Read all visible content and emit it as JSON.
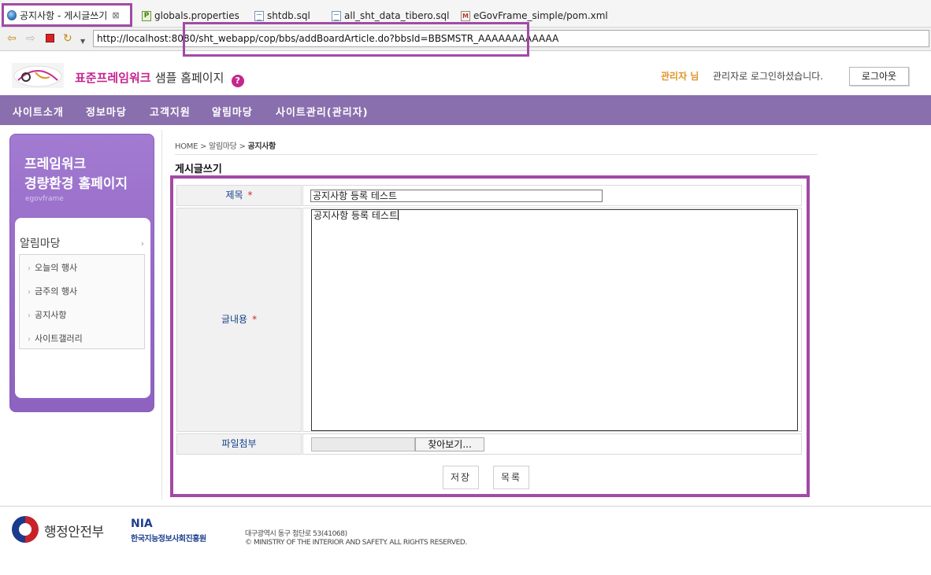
{
  "tabs": [
    {
      "label": "공지사항 - 게시글쓰기",
      "icon": "globe-icon",
      "active": true
    },
    {
      "label": "globals.properties",
      "icon": "properties-file-icon"
    },
    {
      "label": "shtdb.sql",
      "icon": "sql-file-icon"
    },
    {
      "label": "all_sht_data_tibero.sql",
      "icon": "sql-file-icon"
    },
    {
      "label": "eGovFrame_simple/pom.xml",
      "icon": "xml-file-icon"
    }
  ],
  "browser": {
    "url": "http://localhost:8080/sht_webapp/cop/bbs/addBoardArticle.do?bbsId=BBSMSTR_AAAAAAAAAAAA"
  },
  "header": {
    "site_title_highlight": "표준프레임워크",
    "site_title_rest": "샘플 홈페이지",
    "help_icon": "?",
    "user_name": "관리자 님",
    "login_message": "관리자로 로그인하셨습니다.",
    "logout_label": "로그아웃"
  },
  "menu": {
    "items": [
      "사이트소개",
      "정보마당",
      "고객지원",
      "알림마당",
      "사이트관리(관리자)"
    ]
  },
  "sidebar": {
    "title_line1": "프레임워크",
    "title_line2": "경량환경 홈페이지",
    "subtitle": "egovframe",
    "section": "알림마당",
    "items": [
      "오늘의 행사",
      "금주의 행사",
      "공지사항",
      "사이트갤러리"
    ]
  },
  "breadcrumb": {
    "home": "HOME",
    "level1": "알림마당",
    "current": "공지사항"
  },
  "page_title": "게시글쓰기",
  "form": {
    "title_label": "제목",
    "title_value": "공지사항 등록 테스트",
    "content_label": "글내용",
    "content_value": "공지사항 등록 테스트",
    "attach_label": "파일첨부",
    "browse_label": "찾아보기...",
    "required_mark": "*",
    "save_label": "저장",
    "list_label": "목록"
  },
  "footer": {
    "ministry": "행정안전부",
    "nia": "NIA",
    "nia_kr": "한국지능정보사회진흥원",
    "address": "대구광역시 동구 첨단로 53(41068)",
    "copyright": "© MINISTRY OF THE INTERIOR AND SAFETY. ALL RIGHTS RESERVED."
  },
  "colors": {
    "accent_purple": "#8a6fae",
    "highlight_border": "#a24aa6",
    "brand_pink": "#c4268f",
    "user_orange": "#e0952a"
  }
}
